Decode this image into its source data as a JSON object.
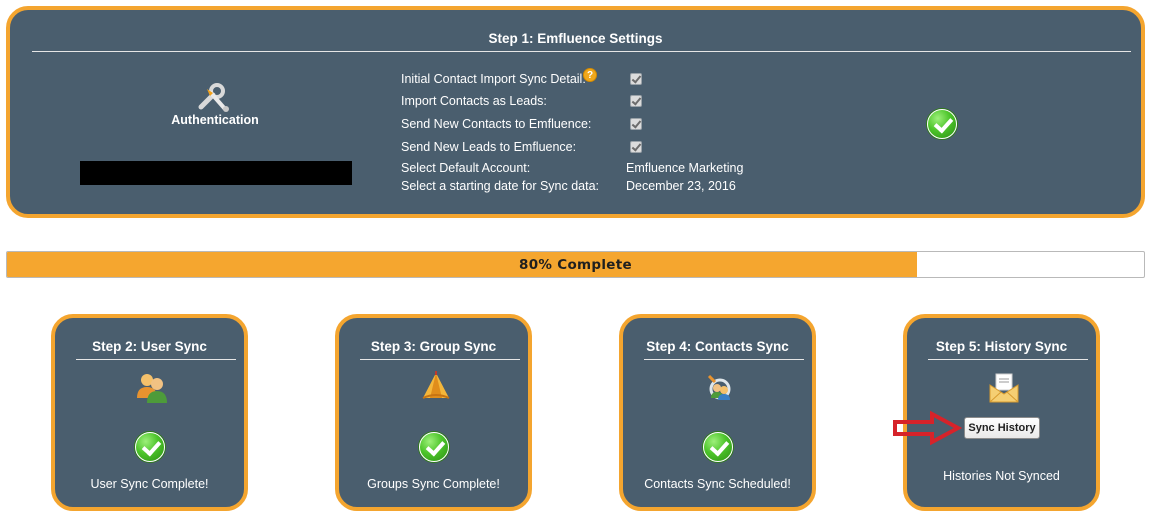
{
  "step1": {
    "title": "Step 1: Emfluence Settings",
    "auth_label": "Authentication",
    "settings": [
      {
        "label": "Initial Contact Import Sync Detail:",
        "checked": true
      },
      {
        "label": "Import Contacts as Leads:",
        "checked": true
      },
      {
        "label": "Send New Contacts to Emfluence:",
        "checked": true
      },
      {
        "label": "Send New Leads to Emfluence:",
        "checked": true
      }
    ],
    "default_account_label": "Select Default Account:",
    "default_account_value": "Emfluence Marketing",
    "start_date_label": "Select a starting date for Sync data:",
    "start_date_value": "December 23, 2016",
    "help_icon": "?",
    "status": "complete"
  },
  "progress": {
    "text": "80% Complete",
    "percent": 80
  },
  "cards": [
    {
      "title": "Step 2: User Sync",
      "icon": "users-icon",
      "status": "User Sync Complete!"
    },
    {
      "title": "Step 3: Group Sync",
      "icon": "group-tent-icon",
      "status": "Groups Sync Complete!"
    },
    {
      "title": "Step 4: Contacts Sync",
      "icon": "contacts-sync-icon",
      "status": "Contacts Sync Scheduled!"
    },
    {
      "title": "Step 5: History Sync",
      "icon": "envelope-icon",
      "status": "Histories Not Synced",
      "button": "Sync History"
    }
  ],
  "colors": {
    "panel_bg": "#4a5e6e",
    "accent_orange": "#f4a52f",
    "success_green": "#4cc42a",
    "annotation_red": "#d6232a"
  }
}
